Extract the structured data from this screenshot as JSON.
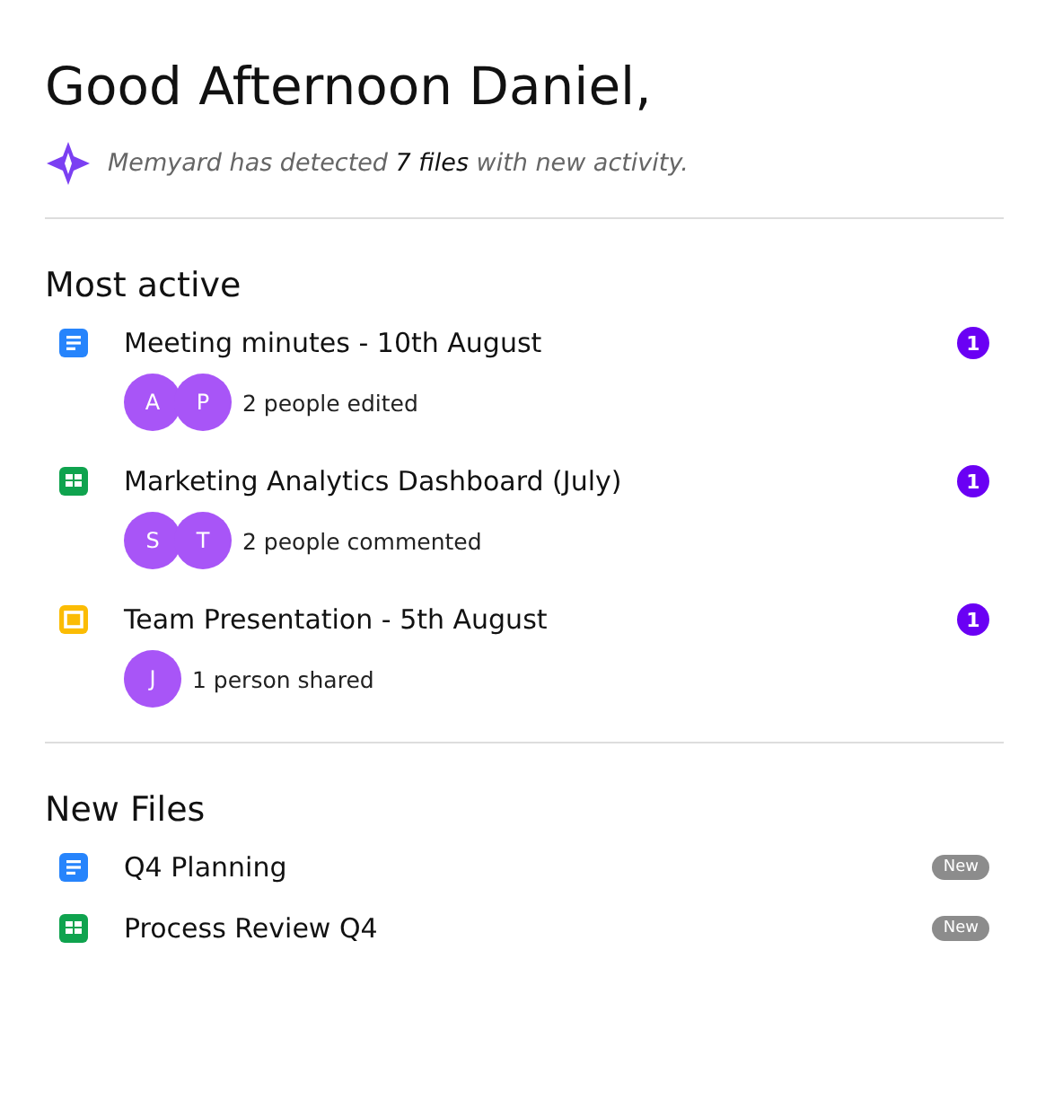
{
  "greeting": "Good Afternoon Daniel,",
  "summary": "Memyard has detected **7 files** with new activity.",
  "sections": [
    {
      "title": "Most active",
      "kind": "activity",
      "items": [
        {
          "kind": "doc",
          "name": "Meeting minutes - 10th August",
          "people": [
            "A",
            "P"
          ],
          "activity": "2 people edited",
          "count": "1"
        },
        {
          "kind": "sheet",
          "name": "Marketing Analytics Dashboard (July)",
          "people": [
            "S",
            "T"
          ],
          "activity": "2 people commented",
          "count": "1"
        },
        {
          "kind": "slides",
          "name": "Team Presentation - 5th August",
          "people": [
            "J"
          ],
          "activity": "1 person shared",
          "count": "1"
        }
      ]
    },
    {
      "title": "New Files",
      "kind": "new",
      "items": [
        {
          "kind": "doc",
          "name": "Q4 Planning",
          "badge": "New"
        },
        {
          "kind": "sheet",
          "name": "Process Review Q4",
          "badge": "New"
        }
      ]
    }
  ]
}
